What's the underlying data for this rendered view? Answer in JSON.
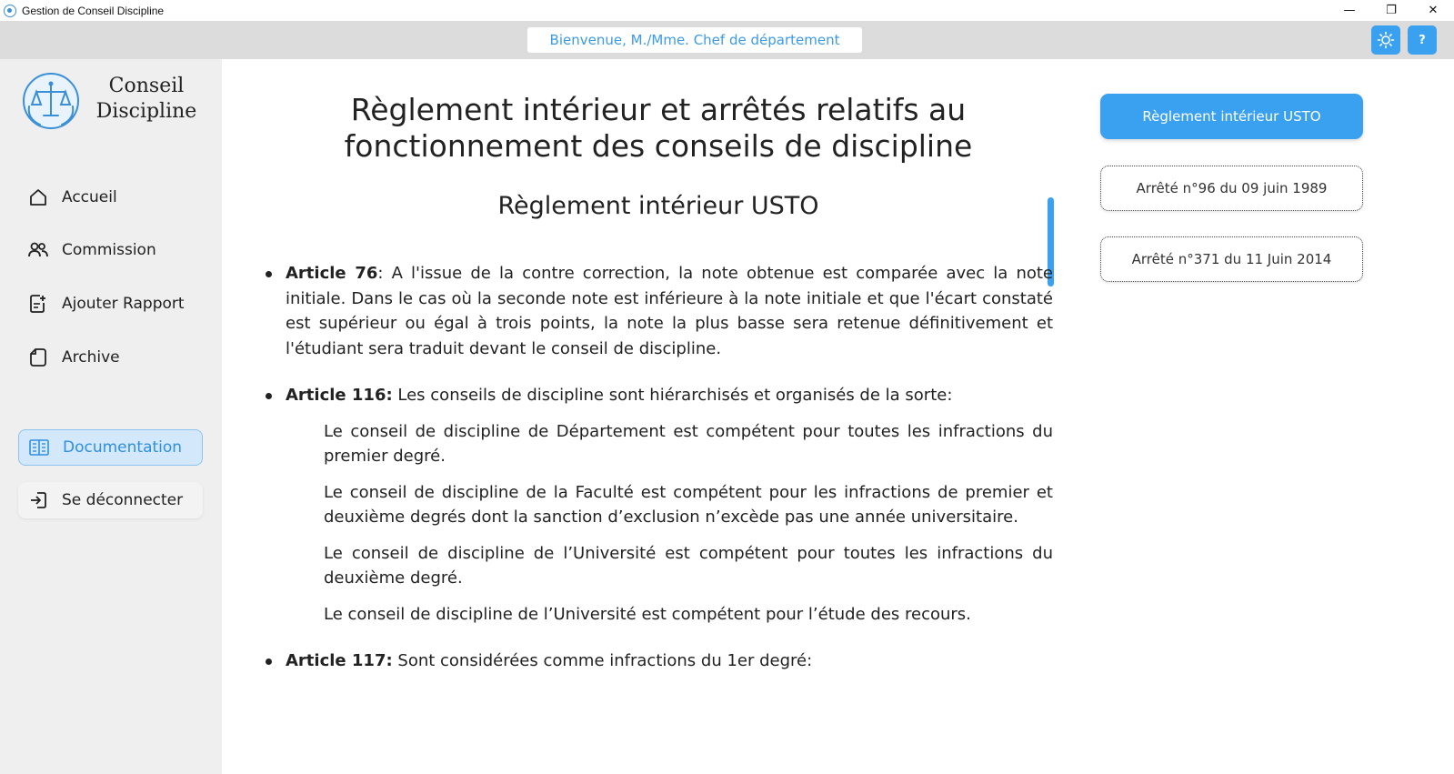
{
  "window": {
    "title": "Gestion de Conseil Discipline",
    "controls": {
      "minimize": "—",
      "restore": "❐",
      "close": "✕"
    }
  },
  "header": {
    "welcome": "Bienvenue, M./Mme. Chef de département",
    "theme_icon": "sun-icon",
    "help_label": "?"
  },
  "sidebar": {
    "logo_line1": "Conseil",
    "logo_line2": "Discipline",
    "items": [
      {
        "label": "Accueil",
        "icon": "home-icon"
      },
      {
        "label": "Commission",
        "icon": "users-icon"
      },
      {
        "label": "Ajouter Rapport",
        "icon": "add-report-icon"
      },
      {
        "label": "Archive",
        "icon": "archive-icon"
      }
    ],
    "documentation": {
      "label": "Documentation",
      "icon": "book-icon"
    },
    "logout": {
      "label": "Se déconnecter",
      "icon": "logout-icon"
    }
  },
  "main": {
    "title_line1": "Règlement intérieur et arrêtés relatifs au",
    "title_line2": "fonctionnement des conseils de discipline",
    "doc_title": "Règlement intérieur USTO",
    "articles": [
      {
        "name": "Article 76",
        "text": ": A l'issue de la contre correction, la note obtenue est comparée avec la note initiale. Dans le cas où la seconde note est inférieure à la note initiale et que l'écart constaté est supérieur ou égal à trois points, la note la plus basse sera retenue définitivement et l'étudiant sera traduit devant le conseil de discipline."
      },
      {
        "name": "Article 116:",
        "text": " Les conseils de discipline sont hiérarchisés et organisés de la sorte:",
        "sub": [
          "Le conseil de discipline de Département est compétent pour toutes les infractions du premier degré.",
          "Le conseil de discipline de la Faculté est compétent pour les infractions de premier et deuxième degrés dont la sanction d’exclusion n’excède pas une année universitaire.",
          "Le conseil de discipline de l’Université est compétent pour toutes les infractions du deuxième degré.",
          "Le conseil de discipline de l’Université est compétent pour l’étude des recours."
        ]
      },
      {
        "name": "Article 117:",
        "text": " Sont considérées comme infractions du 1er degré:"
      }
    ]
  },
  "documents": [
    {
      "label": "Règlement intérieur USTO",
      "selected": true
    },
    {
      "label": "Arrêté n°96 du 09 juin 1989",
      "selected": false
    },
    {
      "label": "Arrêté n°371 du 11 Juin 2014",
      "selected": false
    }
  ]
}
